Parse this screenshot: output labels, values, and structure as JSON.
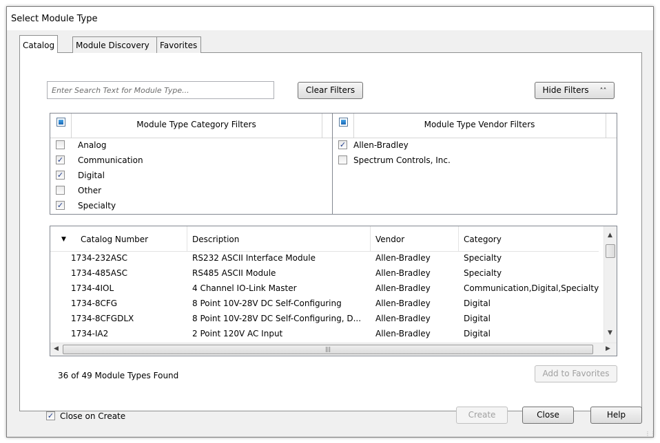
{
  "window": {
    "title": "Select Module Type"
  },
  "tabs": [
    {
      "label": "Catalog",
      "active": true
    },
    {
      "label": "Module Discovery",
      "active": false
    },
    {
      "label": "Favorites",
      "active": false
    }
  ],
  "search": {
    "placeholder": "Enter Search Text for Module Type...",
    "value": ""
  },
  "buttons": {
    "clear_filters": "Clear Filters",
    "hide_filters": "Hide Filters",
    "hide_filters_icon": "double-chevron-up-icon",
    "add_to_favorites": "Add to Favorites",
    "create": "Create",
    "close": "Close",
    "help": "Help"
  },
  "category_filters": {
    "header": "Module Type Category Filters",
    "items": [
      {
        "label": "Analog",
        "checked": false
      },
      {
        "label": "Communication",
        "checked": true
      },
      {
        "label": "Digital",
        "checked": true
      },
      {
        "label": "Other",
        "checked": false
      },
      {
        "label": "Specialty",
        "checked": true
      }
    ]
  },
  "vendor_filters": {
    "header": "Module Type Vendor Filters",
    "items": [
      {
        "label": "Allen-Bradley",
        "checked": true
      },
      {
        "label": "Spectrum Controls, Inc.",
        "checked": false
      }
    ]
  },
  "grid": {
    "sort_icon": "sort-descending-triangle-icon",
    "columns": [
      "Catalog Number",
      "Description",
      "Vendor",
      "Category"
    ],
    "rows": [
      [
        "1734-232ASC",
        "RS232 ASCII Interface Module",
        "Allen-Bradley",
        "Specialty"
      ],
      [
        "1734-485ASC",
        "RS485 ASCII Module",
        "Allen-Bradley",
        "Specialty"
      ],
      [
        "1734-4IOL",
        "4 Channel IO-Link Master",
        "Allen-Bradley",
        "Communication,Digital,Specialty"
      ],
      [
        "1734-8CFG",
        "8 Point 10V-28V DC Self-Configuring",
        "Allen-Bradley",
        "Digital"
      ],
      [
        "1734-8CFGDLX",
        "8 Point 10V-28V DC Self-Configuring, D...",
        "Allen-Bradley",
        "Digital"
      ],
      [
        "1734-IA2",
        "2 Point 120V AC Input",
        "Allen-Bradley",
        "Digital"
      ]
    ]
  },
  "status": {
    "found_text": "36  of 49 Module Types Found"
  },
  "close_on_create": {
    "label": "Close on Create",
    "checked": true
  },
  "colors": {
    "accent_blue": "#1866b4",
    "dialog_bg": "#f0f0f0",
    "border": "#828790"
  }
}
